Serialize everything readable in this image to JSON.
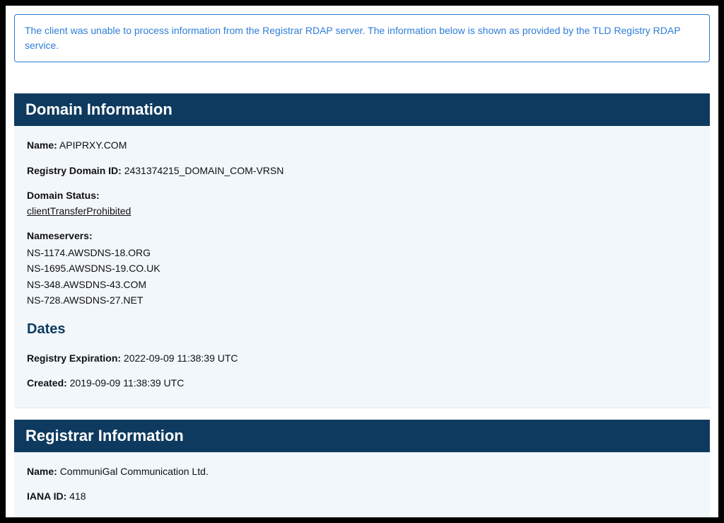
{
  "alert": {
    "message": "The client was unable to process information from the Registrar RDAP server. The information below is shown as provided by the TLD Registry RDAP service."
  },
  "domain_info": {
    "header": "Domain Information",
    "name_label": "Name:",
    "name_value": "APIPRXY.COM",
    "registry_domain_id_label": "Registry Domain ID:",
    "registry_domain_id_value": "2431374215_DOMAIN_COM-VRSN",
    "domain_status_label": "Domain Status:",
    "domain_status_link": "clientTransferProhibited",
    "nameservers_label": "Nameservers:",
    "nameservers": [
      "NS-1174.AWSDNS-18.ORG",
      "NS-1695.AWSDNS-19.CO.UK",
      "NS-348.AWSDNS-43.COM",
      "NS-728.AWSDNS-27.NET"
    ],
    "dates_heading": "Dates",
    "registry_expiration_label": "Registry Expiration:",
    "registry_expiration_value": "2022-09-09 11:38:39 UTC",
    "created_label": "Created:",
    "created_value": "2019-09-09 11:38:39 UTC"
  },
  "registrar_info": {
    "header": "Registrar Information",
    "name_label": "Name:",
    "name_value": "CommuniGal Communication Ltd.",
    "iana_id_label": "IANA ID:",
    "iana_id_value": "418"
  }
}
